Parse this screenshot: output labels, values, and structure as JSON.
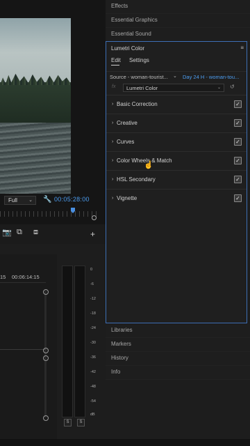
{
  "monitor": {
    "resolution": "Full",
    "timecode": "00:05:28:00"
  },
  "timeline": {
    "times": [
      "15",
      "00:06:14:15"
    ]
  },
  "meters": {
    "scale": [
      "0",
      "-6",
      "-12",
      "-18",
      "-24",
      "-30",
      "-36",
      "-42",
      "-48",
      "-54",
      "dB"
    ],
    "solo_buttons": [
      "S",
      "S"
    ]
  },
  "panels_top": [
    "Effects",
    "Essential Graphics",
    "Essential Sound"
  ],
  "lumetri": {
    "title": "Lumetri Color",
    "tabs": [
      "Edit",
      "Settings"
    ],
    "source": "Source - woman-tourist...",
    "clip": "Day 24 H - woman-tou...",
    "fx_label": "fx",
    "effect_select": "Lumetri Color",
    "sections": [
      {
        "label": "Basic Correction",
        "checked": true
      },
      {
        "label": "Creative",
        "checked": true
      },
      {
        "label": "Curves",
        "checked": true
      },
      {
        "label": "Color Wheels & Match",
        "checked": true
      },
      {
        "label": "HSL Secondary",
        "checked": true
      },
      {
        "label": "Vignette",
        "checked": true
      }
    ]
  },
  "panels_bottom": [
    "Libraries",
    "Markers",
    "History",
    "Info"
  ],
  "colors": {
    "accent_blue": "#4c9df0",
    "panel_focus_border": "#3d6fb5"
  }
}
